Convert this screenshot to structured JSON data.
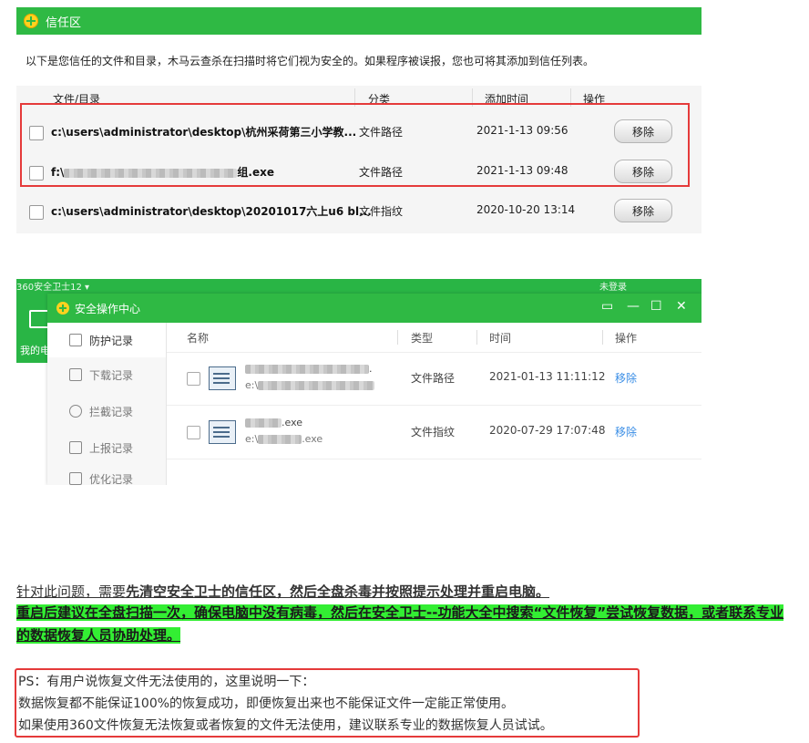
{
  "trust_zone": {
    "title": "信任区",
    "description": "以下是您信任的文件和目录，木马云查杀在扫描时将它们视为安全的。如果程序被误报，您也可将其添加到信任列表。",
    "columns": [
      "文件/目录",
      "分类",
      "添加时间",
      "操作"
    ],
    "rows": [
      {
        "path": "c:\\users\\administrator\\desktop\\杭州采荷第三小学教...",
        "category": "文件路径",
        "time": "2021-1-13 09:56",
        "action": "移除"
      },
      {
        "path_prefix": "f:\\",
        "path_suffix": "组.exe",
        "category": "文件路径",
        "time": "2021-1-13 09:48",
        "action": "移除"
      },
      {
        "path": "c:\\users\\administrator\\desktop\\20201017六上u6 bl...",
        "category": "文件指纹",
        "time": "2020-10-20 13:14",
        "action": "移除"
      }
    ]
  },
  "security_center": {
    "bg_status_left": "360安全卫士12 ▾",
    "bg_status_right": "未登录",
    "bg_label": "我的电",
    "title": "安全操作中心",
    "window_controls": [
      "▭",
      "—",
      "☐",
      "✕"
    ],
    "sidebar": [
      {
        "label": "防护记录",
        "active": true
      },
      {
        "label": "下载记录",
        "active": false
      },
      {
        "label": "拦截记录",
        "active": false
      },
      {
        "label": "上报记录",
        "active": false
      },
      {
        "label": "优化记录",
        "active": false
      }
    ],
    "columns": [
      "名称",
      "类型",
      "时间",
      "操作"
    ],
    "rows": [
      {
        "name_suffix": ".",
        "path_prefix": "e:\\",
        "type": "文件路径",
        "time": "2021-01-13 11:11:12",
        "action": "移除"
      },
      {
        "name_suffix": ".exe",
        "path_prefix": "e:\\",
        "path_suffix": ".exe",
        "type": "文件指纹",
        "time": "2020-07-29 17:07:48",
        "action": "移除"
      }
    ]
  },
  "text": {
    "line1_normal": "针对此问题，需要",
    "line1_bold": "先清空安全卫士的信任区，然后全盘杀毒并按照提示处理并重启电脑。",
    "line2": "重启后建议在全盘扫描一次，确保电脑中没有病毒，然后在安全卫士--功能大全中搜索“文件恢复”尝试恢复数据，或者联系专业的数据恢复人员协助处理。",
    "ps_lines": [
      "PS：有用户说恢复文件无法使用的，这里说明一下：",
      "数据恢复都不能保证100%的恢复成功，即便恢复出来也不能保证文件一定能正常使用。",
      "如果使用360文件恢复无法恢复或者恢复的文件无法使用，建议联系专业的数据恢复人员试试。"
    ]
  }
}
